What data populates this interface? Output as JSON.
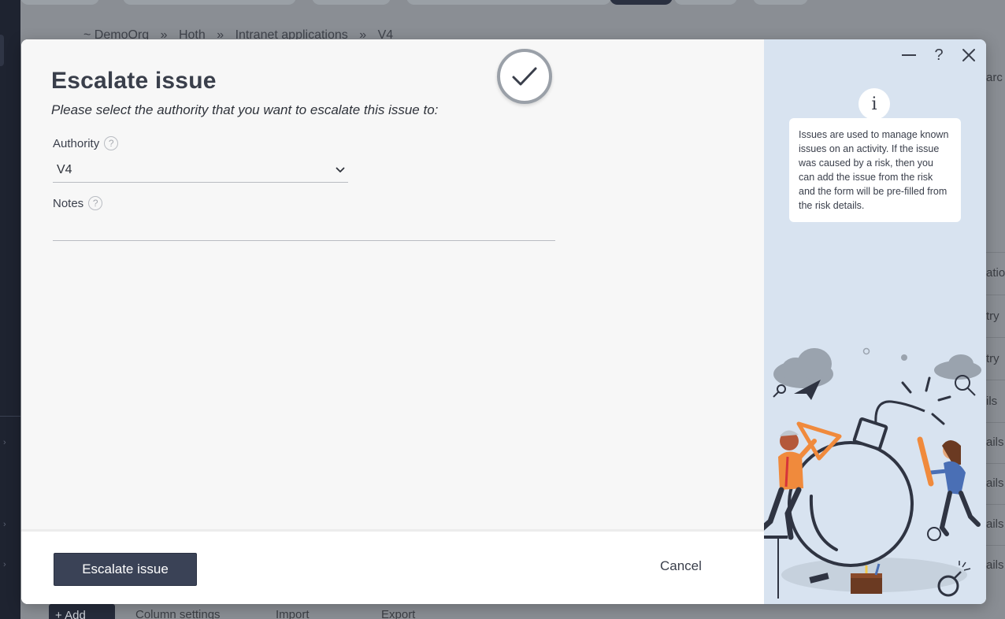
{
  "background": {
    "breadcrumbs": [
      "~ DemoOrg",
      "»",
      "Hoth",
      "»",
      "Intranet applications",
      "»",
      "V4"
    ],
    "right_column_rows": [
      "arc",
      "atio",
      "try",
      "try",
      "ils",
      "ails",
      "ails",
      "ails",
      "ails"
    ],
    "bottom_toolbar": {
      "add_label": "+ Add",
      "column_settings_label": "Column settings",
      "import_label": "Import",
      "export_label": "Export"
    }
  },
  "modal": {
    "title": "Escalate issue",
    "subtitle": "Please select the authority that you want to escalate this issue to:",
    "authority": {
      "label": "Authority",
      "help": "?",
      "value": "V4"
    },
    "notes": {
      "label": "Notes",
      "help": "?",
      "value": "",
      "placeholder": ""
    },
    "footer": {
      "primary_label": "Escalate issue",
      "cancel_label": "Cancel"
    },
    "window_controls": {
      "help": "?"
    },
    "info": {
      "badge": "i",
      "text": "Issues are used to manage known issues on an activity. If the issue was caused by a risk, then you can add the issue from the risk and the form will be pre-filled from the risk details."
    }
  },
  "colors": {
    "primary_button": "#3a4256",
    "right_panel": "#d8e3f0",
    "accent_orange": "#f08a3c",
    "accent_blue": "#4a6fb5",
    "ink": "#3a3f4b"
  }
}
